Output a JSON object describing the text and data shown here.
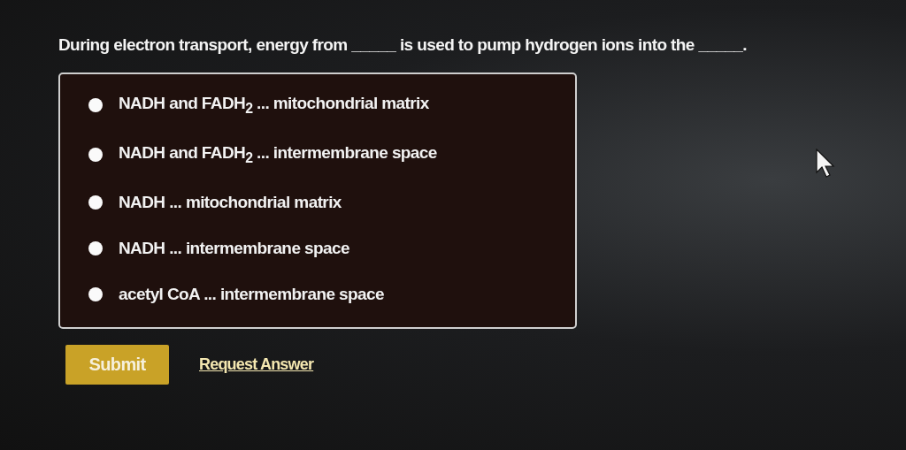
{
  "question": {
    "parts": [
      "During electron transport, energy from",
      "_____",
      "is used to pump hydrogen ions into the",
      "_____",
      "."
    ]
  },
  "options": [
    {
      "label": "NADH and FADH$_{2}$ ... mitochondrial matrix",
      "selected": false
    },
    {
      "label": "NADH and FADH$_{2}$ ... intermembrane space",
      "selected": false
    },
    {
      "label": "NADH ... mitochondrial matrix",
      "selected": false
    },
    {
      "label": "NADH ... intermembrane space",
      "selected": false
    },
    {
      "label": "acetyl CoA ... intermembrane space",
      "selected": false
    }
  ],
  "actions": {
    "submit": "Submit",
    "link": "Request Answer"
  }
}
